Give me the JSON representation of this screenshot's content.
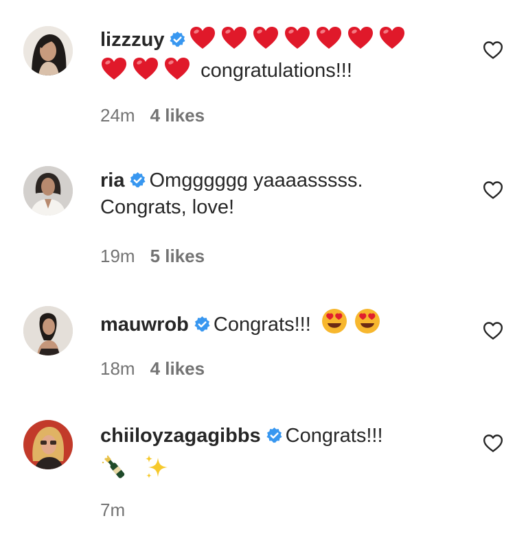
{
  "comments": [
    {
      "username": "lizzzuy",
      "verified": true,
      "text": "congratulations!!!",
      "leading_emoji": [
        "red-heart",
        "red-heart",
        "red-heart",
        "red-heart",
        "red-heart",
        "red-heart",
        "red-heart",
        "red-heart",
        "red-heart",
        "red-heart"
      ],
      "time": "24m",
      "likes": "4 likes"
    },
    {
      "username": "ria",
      "verified": true,
      "text_line1": "Omgggggg yaaaasssss.",
      "text_line2": "Congrats, love!",
      "time": "19m",
      "likes": "5 likes"
    },
    {
      "username": "mauwrob",
      "verified": true,
      "text": "Congrats!!!",
      "trailing_emoji": [
        "heart-eyes-face",
        "heart-eyes-face"
      ],
      "time": "18m",
      "likes": "4 likes"
    },
    {
      "username": "chiiloyzagagibbs",
      "verified": true,
      "text": "Congrats!!!",
      "trailing_emoji": [
        "champagne-bottle",
        "sparkles"
      ],
      "time": "7m"
    }
  ],
  "colors": {
    "verified_blue": "#3897f0",
    "heart_red": "#e0192a",
    "meta_gray": "#737373",
    "text": "#262626"
  }
}
